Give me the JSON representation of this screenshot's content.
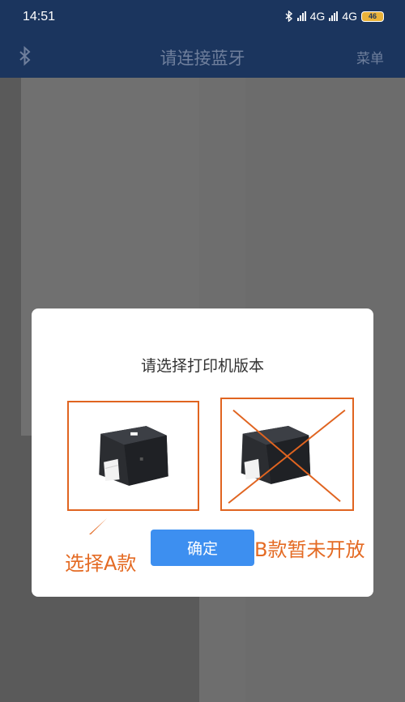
{
  "status_bar": {
    "time": "14:51",
    "network_1": "4G",
    "network_2": "4G",
    "battery": "46"
  },
  "app_bar": {
    "icon": "bluetooth-icon",
    "title": "请连接蓝牙",
    "menu_label": "菜单"
  },
  "dialog": {
    "title": "请选择打印机版本",
    "option_a_image": "printer-icon",
    "option_b_image": "printer-icon",
    "option_b_status": "crossed-out",
    "confirm_label": "确定"
  },
  "annotations": {
    "option_a": "选择A款",
    "option_b": "B款暂未开放"
  },
  "colors": {
    "app_bar": "#1b355e",
    "accent_button": "#3d8ff0",
    "annotation": "#e46b24"
  }
}
